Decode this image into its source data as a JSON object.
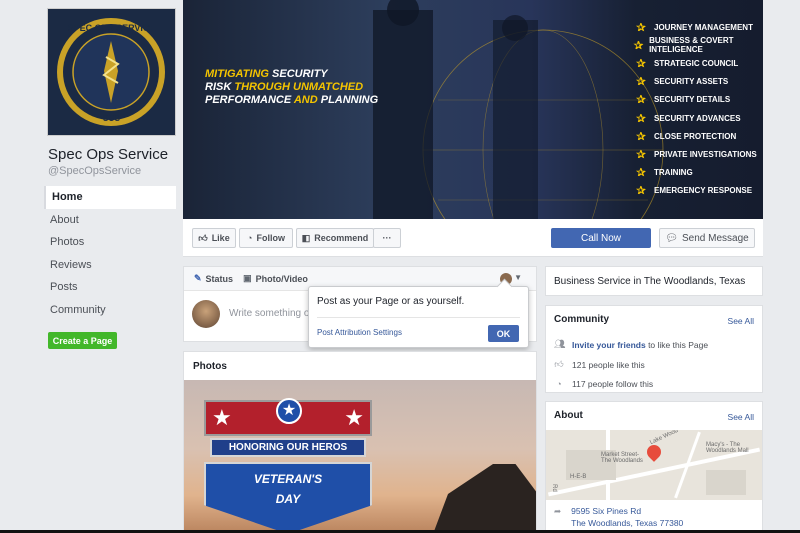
{
  "page": {
    "name": "Spec Ops Service",
    "handle": "@SpecOpsService",
    "logo_text_top": "SPEC OPS SERVICE",
    "logo_text_bottom": "SOS"
  },
  "left_nav": {
    "items": [
      "Home",
      "About",
      "Photos",
      "Reviews",
      "Posts",
      "Community"
    ],
    "create_page": "Create a Page"
  },
  "cover": {
    "slogan_line1_a": "MITIGATING",
    "slogan_line1_b": "SECURITY",
    "slogan_line2_a": "RISK",
    "slogan_line2_b": "THROUGH UNMATCHED",
    "slogan_line3_a": "PERFORMANCE",
    "slogan_line3_b": "AND",
    "slogan_line3_c": "PLANNING",
    "services": [
      "JOURNEY MANAGEMENT",
      "BUSINESS & COVERT INTELIGENCE",
      "STRATEGIC COUNCIL",
      "SECURITY ASSETS",
      "SECURITY DETAILS",
      "SECURITY ADVANCES",
      "CLOSE PROTECTION",
      "PRIVATE INVESTIGATIONS",
      "TRAINING",
      "EMERGENCY RESPONSE"
    ]
  },
  "actions": {
    "like": "Like",
    "follow": "Follow",
    "recommend": "Recommend",
    "more": "···",
    "call_now": "Call Now",
    "send_message": "Send Message"
  },
  "composer": {
    "tab_status": "Status",
    "tab_photo": "Photo/Video",
    "placeholder": "Write something o"
  },
  "popover": {
    "text": "Post as your Page or as yourself.",
    "link": "Post Attribution Settings",
    "ok": "OK"
  },
  "photos": {
    "title": "Photos",
    "banner_mid": "HONORING OUR HEROS",
    "banner_t1": "VETERAN'S",
    "banner_t2": "DAY"
  },
  "right": {
    "business": "Business Service in The Woodlands, Texas",
    "community": {
      "title": "Community",
      "see_all": "See All",
      "invite_link": "Invite your friends",
      "invite_rest": "to like this Page",
      "likes": "121 people like this",
      "follows": "117 people follow this"
    },
    "about": {
      "title": "About",
      "see_all": "See All",
      "address1": "9595 Six Pines Rd",
      "address2": "The Woodlands, Texas 77380",
      "map_labels": [
        "Market Street-The Woodlands",
        "Macy's - The Woodlands Mall",
        "Lake Wood",
        "Rd",
        "H-E-B"
      ]
    }
  },
  "colors": {
    "fb_blue": "#4267b2",
    "link": "#365899",
    "green": "#42b72a",
    "bg": "#e9ebee",
    "accent_yellow": "#f4c400"
  }
}
